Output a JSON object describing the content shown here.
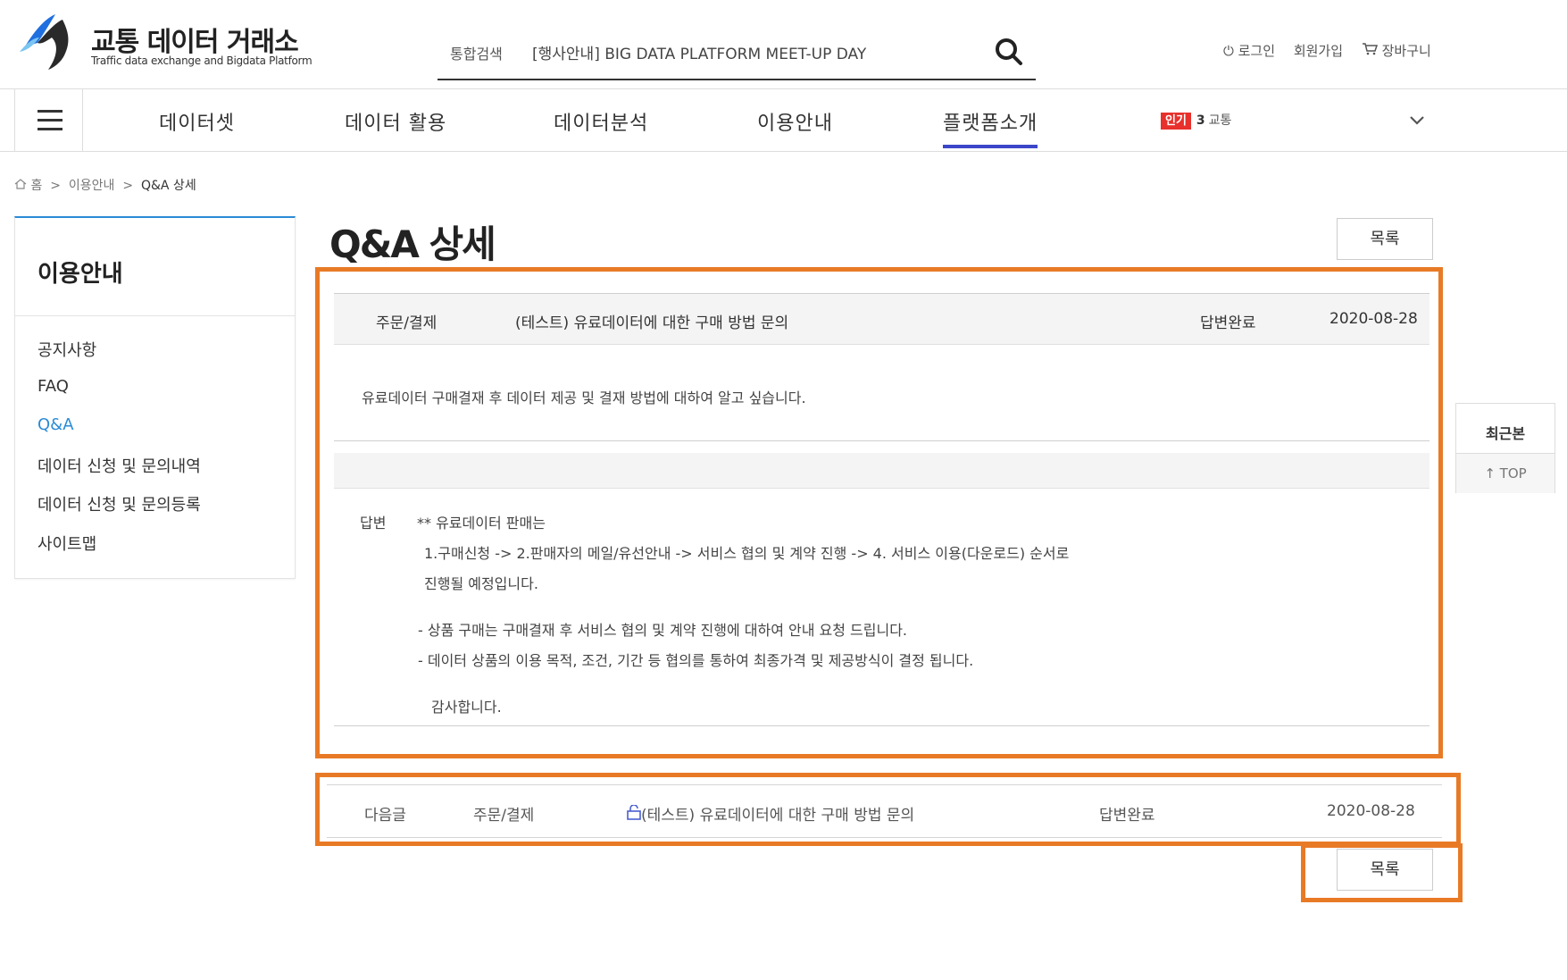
{
  "header": {
    "logo_title": "교통 데이터 거래소",
    "logo_subtitle": "Traffic data exchange and Bigdata Platform",
    "search_label": "통합검색",
    "search_value": "[행사안내] BIG DATA PLATFORM MEET-UP DAY",
    "util_links": {
      "login": "⏻ 로그인",
      "signup": "회원가입",
      "cart": "장바구니"
    }
  },
  "nav": {
    "items": [
      "데이터셋",
      "데이터 활용",
      "데이터분석",
      "이용안내",
      "플랫폼소개"
    ],
    "active_index": 4,
    "popular_badge": "인기",
    "popular_rank": "3",
    "popular_keyword": "교통"
  },
  "breadcrumb": {
    "home": "홈",
    "level1": "이용안내",
    "current": "Q&A 상세"
  },
  "sidebar": {
    "title": "이용안내",
    "items": [
      "공지사항",
      "FAQ",
      "Q&A",
      "데이터 신청 및 문의내역",
      "데이터 신청 및 문의등록",
      "사이트맵"
    ],
    "active_index": 2
  },
  "page_title": "Q&A 상세",
  "list_button": "목록",
  "qa": {
    "category": "주문/결제",
    "title": "(테스트) 유료데이터에 대한 구매 방법 문의",
    "status": "답변완료",
    "date": "2020-08-28",
    "question": "유료데이터 구매결재 후 데이터 제공 및 결재 방법에 대하여 알고 싶습니다.",
    "answer_label": "답변",
    "answer_lines": [
      "** 유료데이터 판매는",
      "1.구매신청 -> 2.판매자의 메일/유선안내 -> 서비스 협의 및 계약 진행 -> 4. 서비스 이용(다운로드) 순서로",
      "진행될 예정입니다.",
      "- 상품 구매는 구매결재 후 서비스 협의 및 계약 진행에 대하여 안내 요청 드립니다.",
      "- 데이터 상품의 이용 목적, 조건, 기간 등 협의를 통하여 최종가격 및 제공방식이 결정 됩니다.",
      "감사합니다."
    ]
  },
  "next_post": {
    "label": "다음글",
    "category": "주문/결제",
    "title": "(테스트) 유료데이터에 대한 구매 방법 문의",
    "status": "답변완료",
    "date": "2020-08-28"
  },
  "floating": {
    "recent": "최근본",
    "top": "TOP"
  },
  "colors": {
    "accent_blue": "#2a8bd6",
    "nav_active": "#3b46c8",
    "highlight_orange": "#e87a26",
    "badge_red": "#e8302c"
  }
}
